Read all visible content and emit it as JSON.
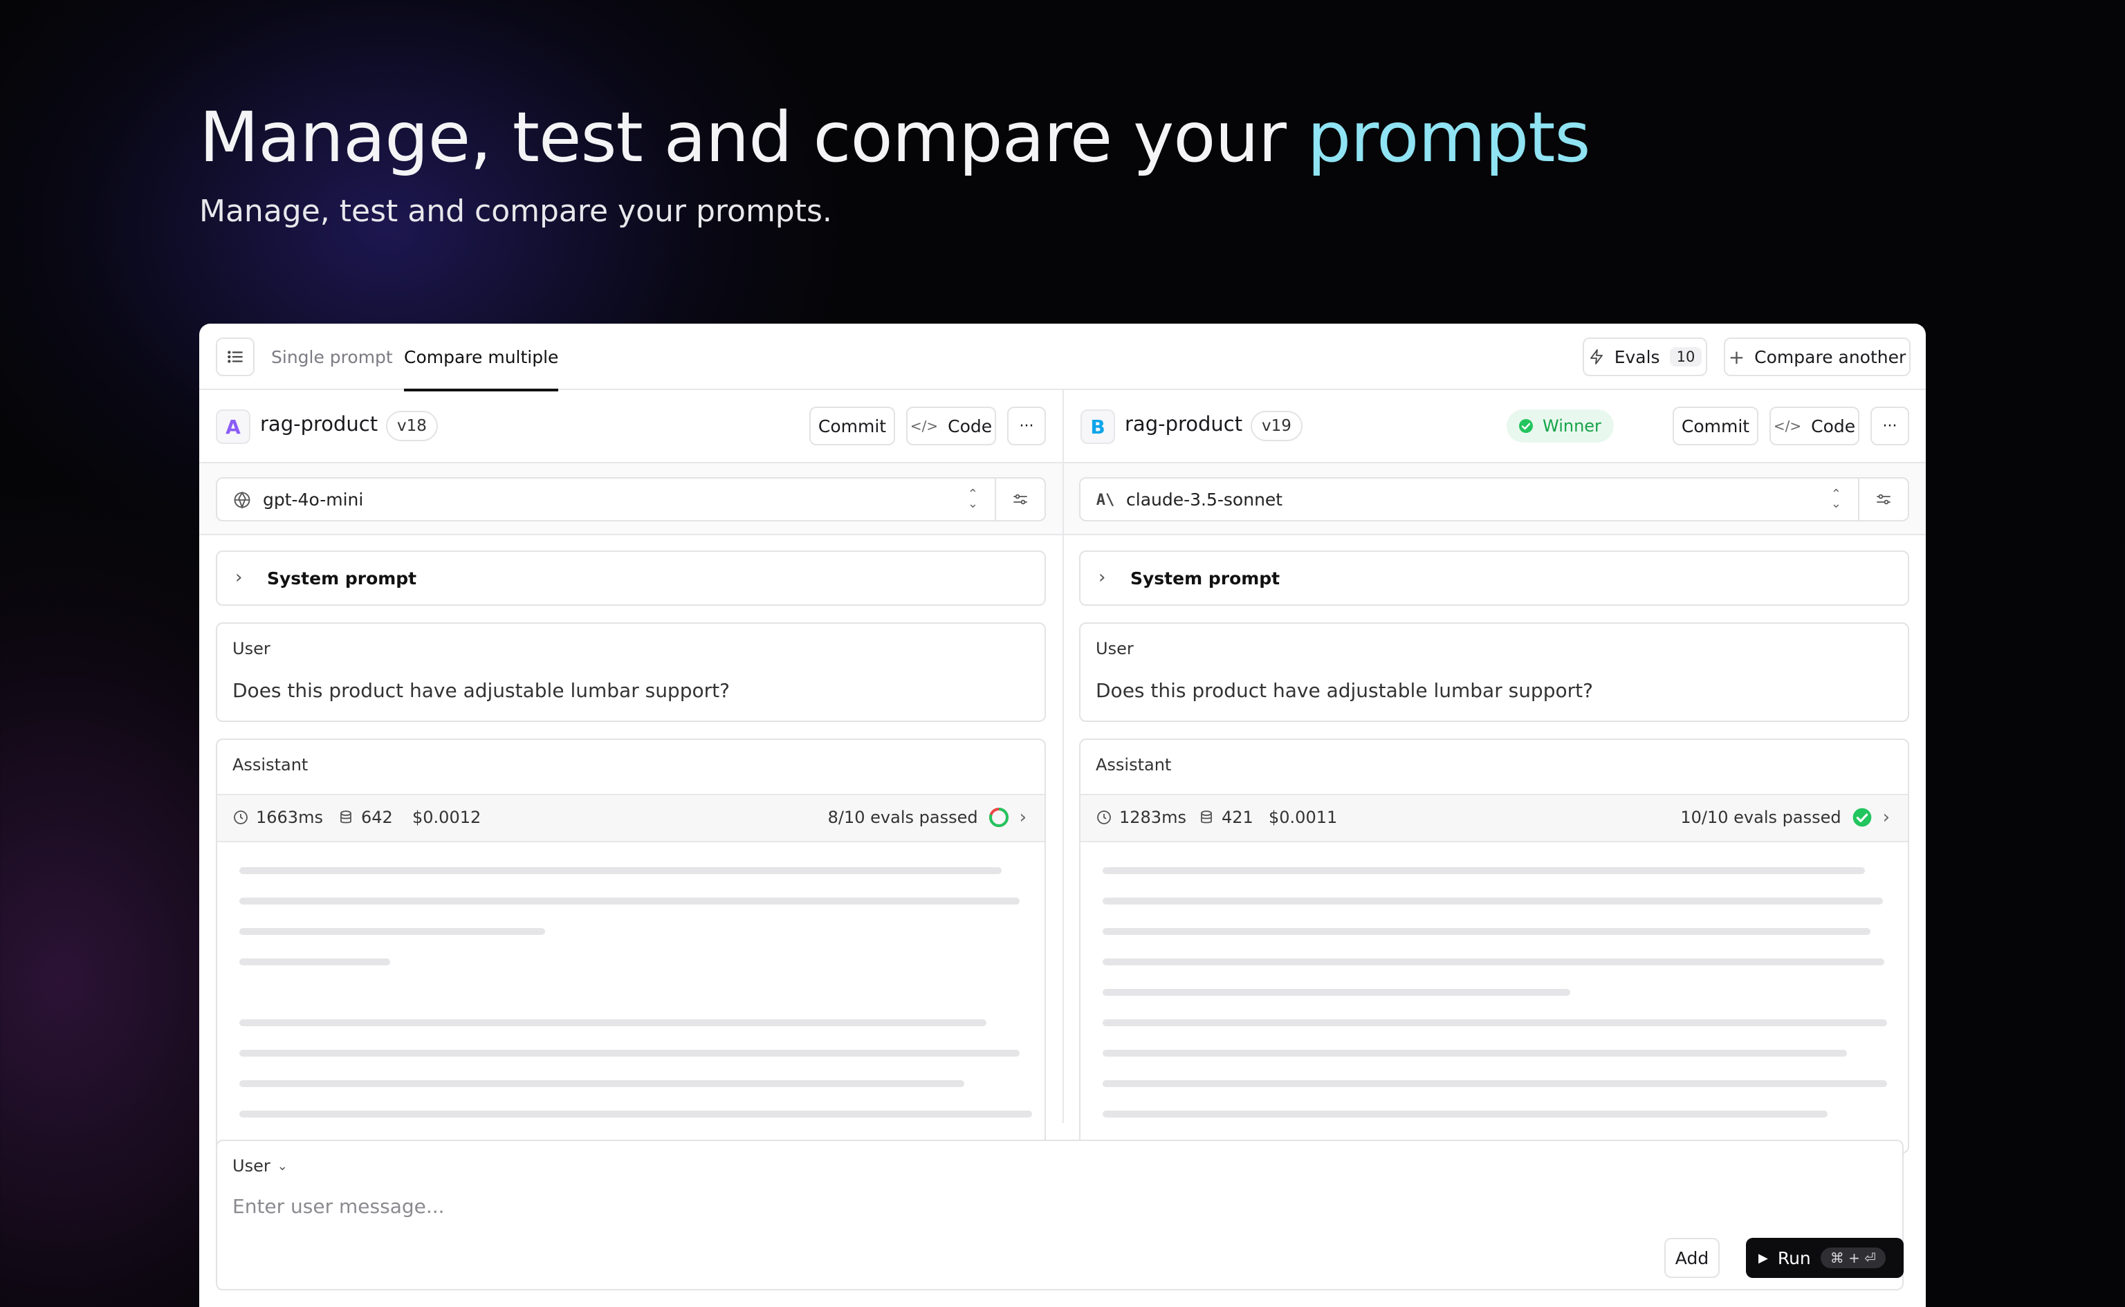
{
  "hero": {
    "title_main": "Manage, test and compare your ",
    "title_accent": "prompts",
    "subtitle": "Manage, test and compare your prompts."
  },
  "toolbar": {
    "tabs": [
      {
        "label": "Single prompt",
        "active": false
      },
      {
        "label": "Compare multiple",
        "active": true
      }
    ],
    "evals_label": "Evals",
    "evals_count": "10",
    "compare_another_label": "Compare another"
  },
  "panels": [
    {
      "letter": "A",
      "letter_color": "#8b5cf6",
      "prompt_name": "rag-product",
      "version": "v18",
      "winner": false,
      "commit_label": "Commit",
      "code_label": "Code",
      "more_label": "···",
      "model_name": "gpt-4o-mini",
      "model_icon": "openai-icon",
      "system_prompt_label": "System prompt",
      "user_role": "User",
      "user_message": "Does this product have adjustable lumbar support?",
      "assistant_role": "Assistant",
      "latency": "1663ms",
      "tokens": "642",
      "cost": "$0.0012",
      "evals_passed": "8/10 evals passed",
      "evals_fraction": 0.8
    },
    {
      "letter": "B",
      "letter_color": "#0ea5e9",
      "prompt_name": "rag-product",
      "version": "v19",
      "winner": true,
      "winner_label": "Winner",
      "commit_label": "Commit",
      "code_label": "Code",
      "more_label": "···",
      "model_name": "claude-3.5-sonnet",
      "model_icon": "anthropic-icon",
      "system_prompt_label": "System prompt",
      "user_role": "User",
      "user_message": "Does this product have adjustable lumbar support?",
      "assistant_role": "Assistant",
      "latency": "1283ms",
      "tokens": "421",
      "cost": "$0.0011",
      "evals_passed": "10/10 evals passed",
      "evals_fraction": 1.0
    }
  ],
  "composer": {
    "role": "User",
    "placeholder": "Enter user message...",
    "add_label": "Add",
    "run_label": "Run",
    "run_shortcut": "⌘ + ⏎"
  },
  "colors": {
    "accent": "#8fe3f2",
    "success": "#22c55e",
    "ring_track": "#ef4444"
  }
}
